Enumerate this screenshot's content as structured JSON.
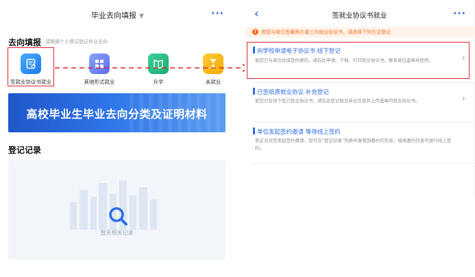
{
  "left": {
    "header_title": "毕业去向填报",
    "section_title": "去向填报",
    "section_hint": "请根据个人情况登记毕业去向",
    "tiles": [
      {
        "label": "签就业协议书就业",
        "icon": "contract-icon",
        "color": "#1d7cf2"
      },
      {
        "label": "其他形式就业",
        "icon": "grid-icon",
        "color": "#5b6ff0"
      },
      {
        "label": "升学",
        "icon": "book-icon",
        "color": "#15ad72"
      },
      {
        "label": "未就业",
        "icon": "hourglass-icon",
        "color": "#f5a800"
      }
    ],
    "banner_text": "高校毕业生毕业去向分类及证明材料",
    "records_title": "登记记录",
    "empty_text": "暂无相关记录"
  },
  "right": {
    "header_title": "签就业协议书就业",
    "notice": "若您与单位签署两方或三方就业协议书，请选择下列方式登记",
    "options": [
      {
        "title": "向学校申请电子协议书 线下登记",
        "desc": "如您已与单位达成签约意向，请在此申请、下载、打印就业协议书，联系单位盖章并回传。"
      },
      {
        "title": "已签纸质就业协议 补充登记",
        "desc": "如您已在线下签订就业协议书，请在此登记就业单位信息并上传盖章的就业协议书。"
      },
      {
        "title": "单位发起签约邀请 等待线上签约",
        "desc": "若企业对您发起签约邀请，您可在“登记记录”列表中查看到邀约的信息，接收邀约信息可进行线上签约。"
      }
    ]
  },
  "colors": {
    "accent": "#2c6be6",
    "highlight": "#d9262c",
    "warning": "#ff6a1a"
  }
}
